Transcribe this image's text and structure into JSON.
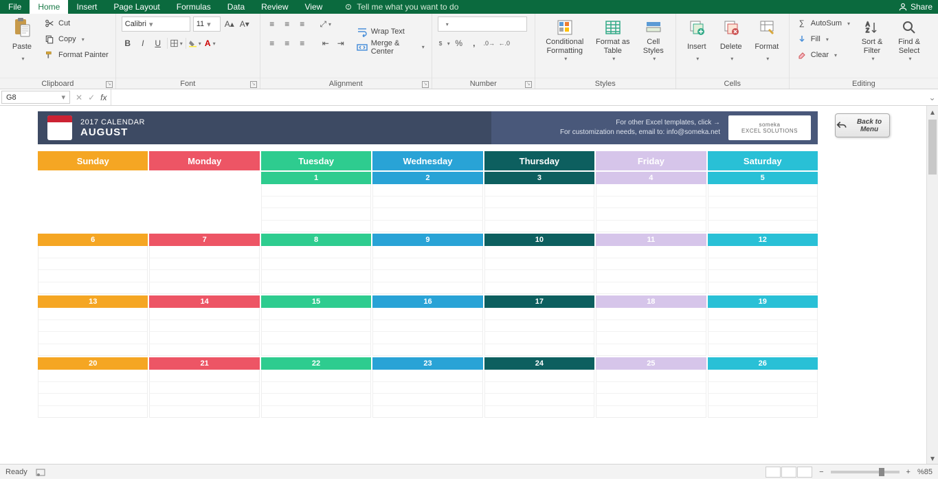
{
  "app": {
    "tabs": [
      "File",
      "Home",
      "Insert",
      "Page Layout",
      "Formulas",
      "Data",
      "Review",
      "View"
    ],
    "active_tab": "Home",
    "tellme": "Tell me what you want to do",
    "share": "Share"
  },
  "ribbon": {
    "clipboard": {
      "label": "Clipboard",
      "paste": "Paste",
      "cut": "Cut",
      "copy": "Copy",
      "format_painter": "Format Painter"
    },
    "font": {
      "label": "Font",
      "name": "Calibri",
      "size": "11"
    },
    "alignment": {
      "label": "Alignment",
      "wrap": "Wrap Text",
      "merge": "Merge & Center"
    },
    "number": {
      "label": "Number"
    },
    "styles": {
      "label": "Styles",
      "cond": "Conditional Formatting",
      "table": "Format as Table",
      "cell": "Cell Styles"
    },
    "cells": {
      "label": "Cells",
      "insert": "Insert",
      "delete": "Delete",
      "format": "Format"
    },
    "editing": {
      "label": "Editing",
      "autosum": "AutoSum",
      "fill": "Fill",
      "clear": "Clear",
      "sort": "Sort & Filter",
      "find": "Find & Select"
    }
  },
  "formula_bar": {
    "cell_ref": "G8",
    "formula": ""
  },
  "calendar": {
    "year_label": "2017 CALENDAR",
    "month": "AUGUST",
    "link1": "For other Excel templates, click →",
    "link2": "For customization needs, email to: info@someka.net",
    "logo": "someka",
    "logo_sub": "EXCEL SOLUTIONS",
    "back_btn": "Back to Menu",
    "days": [
      "Sunday",
      "Monday",
      "Tuesday",
      "Wednesday",
      "Thursday",
      "Friday",
      "Saturday"
    ],
    "day_colors": [
      "#f5a623",
      "#ed5565",
      "#2ecc8f",
      "#29a3d6",
      "#0d5f5f",
      "#d6c5ea",
      "#29c0d6"
    ],
    "weeks": [
      [
        null,
        null,
        1,
        2,
        3,
        4,
        5
      ],
      [
        6,
        7,
        8,
        9,
        10,
        11,
        12
      ],
      [
        13,
        14,
        15,
        16,
        17,
        18,
        19
      ],
      [
        20,
        21,
        22,
        23,
        24,
        25,
        26
      ]
    ]
  },
  "status": {
    "ready": "Ready",
    "zoom": "%85"
  }
}
